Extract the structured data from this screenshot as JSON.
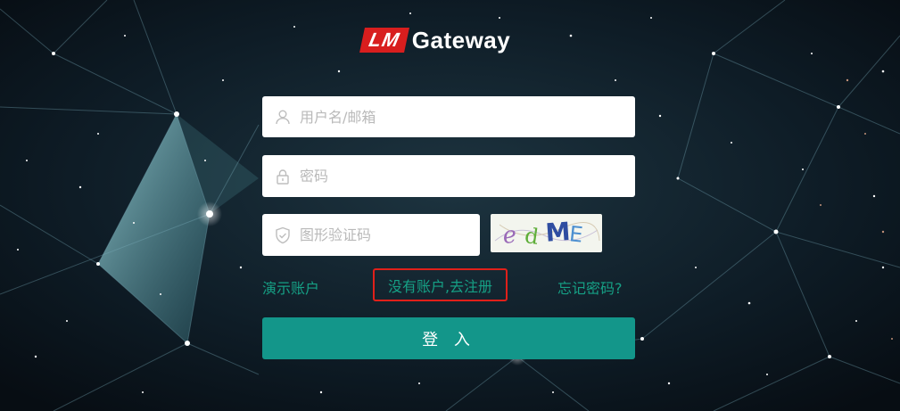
{
  "logo": {
    "badge": "LM",
    "text": "Gateway"
  },
  "form": {
    "username": {
      "placeholder": "用户名/邮箱",
      "icon": "user-icon"
    },
    "password": {
      "placeholder": "密码",
      "icon": "lock-icon"
    },
    "captcha": {
      "placeholder": "图形验证码",
      "icon": "shield-check-icon",
      "image_text": "edME"
    }
  },
  "links": {
    "demo": "演示账户",
    "register": "没有账户,去注册",
    "forgot": "忘记密码?"
  },
  "login_button": "登 入",
  "colors": {
    "accent": "#13968a",
    "link": "#16a085",
    "highlight_border": "#e0201a",
    "logo_badge": "#d81e1e",
    "background": "#0b1620"
  }
}
